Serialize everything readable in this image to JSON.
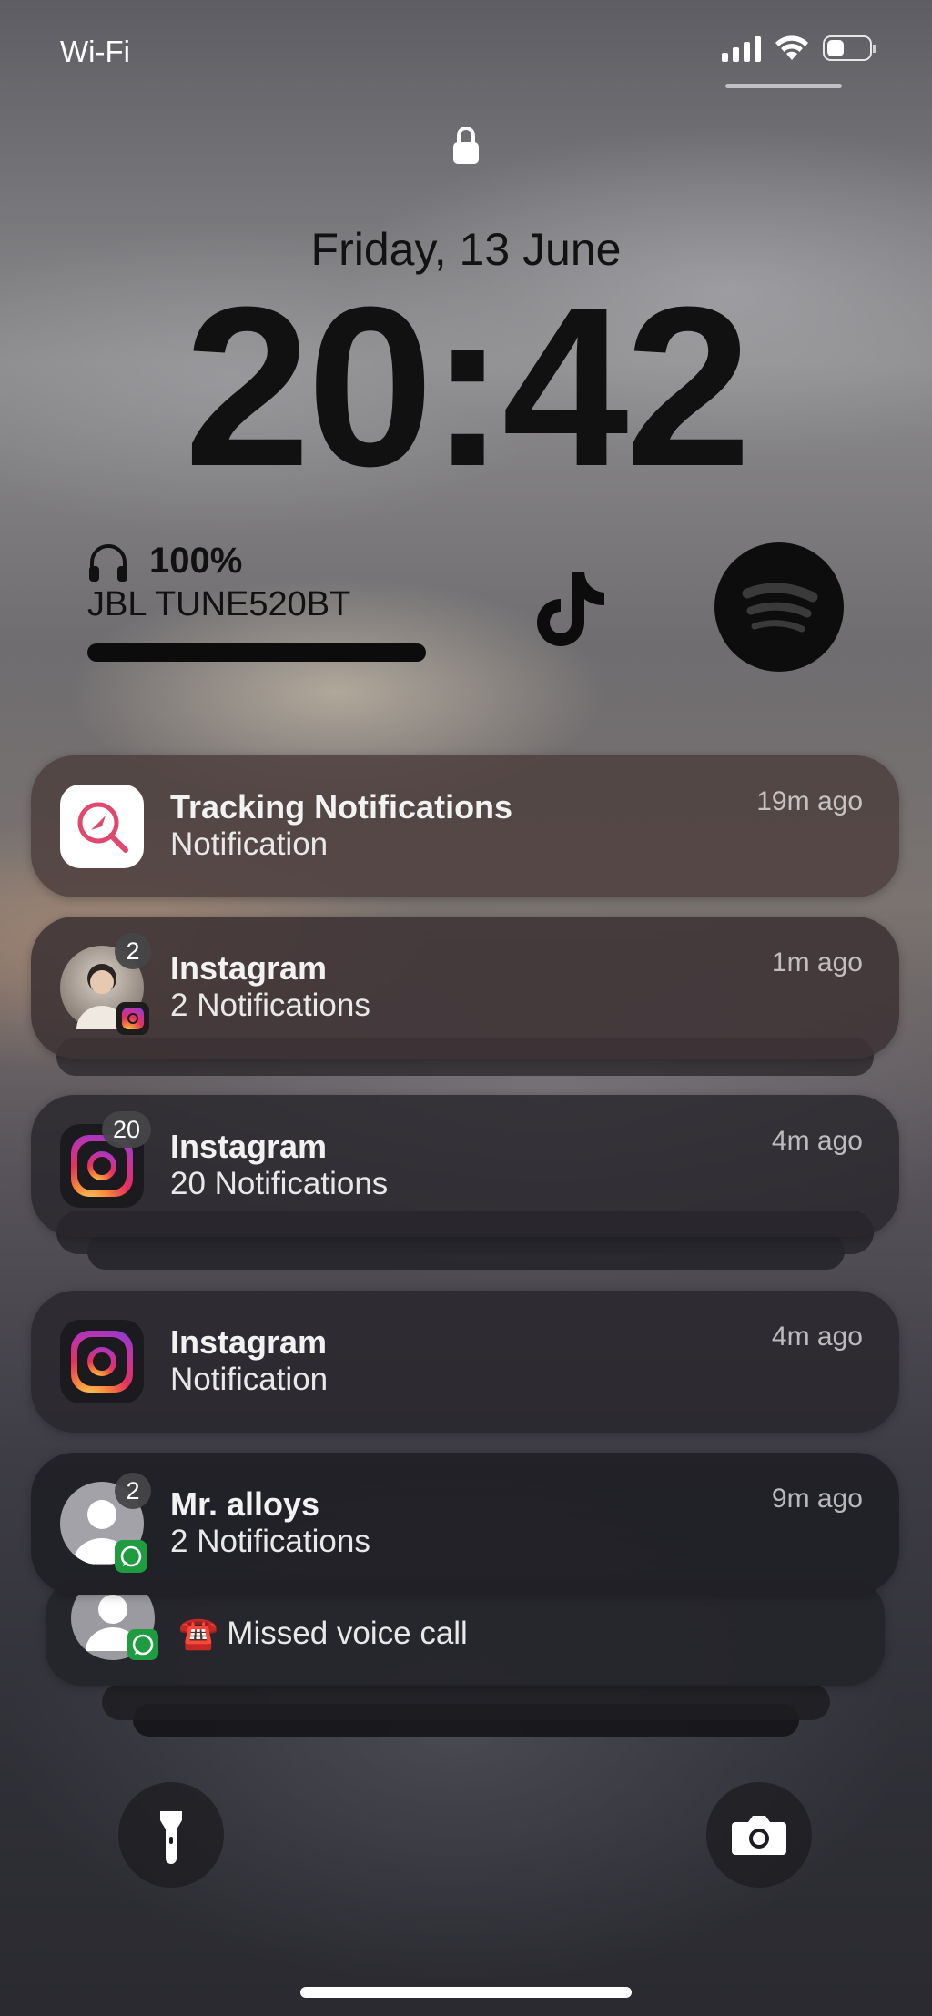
{
  "status_bar": {
    "carrier": "Wi-Fi",
    "battery_level": 0.4
  },
  "lock_screen": {
    "date": "Friday, 13 June",
    "time": "20:42"
  },
  "widgets": {
    "headphones": {
      "battery": "100%",
      "device": "JBL TUNE520BT",
      "battery_level": 1.0
    },
    "apps": [
      "tiktok-icon",
      "spotify-icon"
    ]
  },
  "notifications": [
    {
      "app": "Tracking Notifications",
      "subtitle": "Notification",
      "time": "19m ago"
    },
    {
      "app": "Instagram",
      "subtitle": "2 Notifications",
      "time": "1m ago",
      "badge": "2"
    },
    {
      "app": "Instagram",
      "subtitle": "20 Notifications",
      "time": "4m ago",
      "badge": "20"
    },
    {
      "app": "Instagram",
      "subtitle": "Notification",
      "time": "4m ago"
    },
    {
      "app": "Mr. alloys",
      "subtitle": "2 Notifications",
      "time": "9m ago",
      "badge": "2"
    },
    {
      "app": "",
      "subtitle": "☎️ Missed voice call",
      "time": ""
    }
  ],
  "controls": {
    "left": "flashlight-icon",
    "right": "camera-icon"
  }
}
